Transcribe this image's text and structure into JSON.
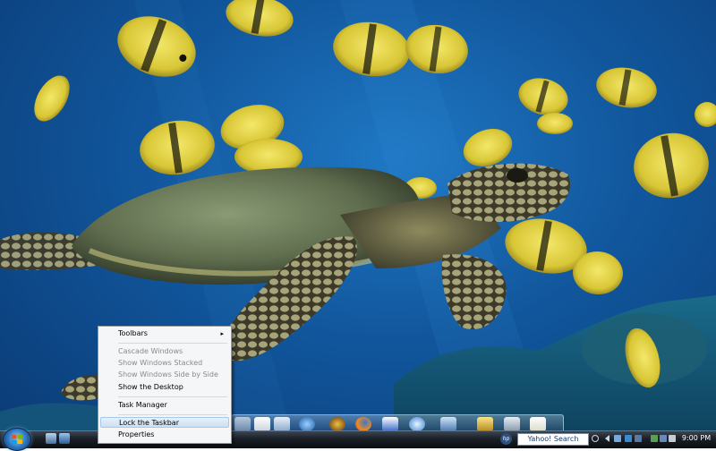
{
  "context_menu": {
    "items": [
      {
        "label": "Toolbars",
        "state": "normal",
        "submenu": true
      },
      {
        "label": "Cascade Windows",
        "state": "disabled"
      },
      {
        "label": "Show Windows Stacked",
        "state": "disabled"
      },
      {
        "label": "Show Windows Side by Side",
        "state": "disabled"
      },
      {
        "label": "Show the Desktop",
        "state": "normal"
      },
      {
        "label": "Task Manager",
        "state": "normal"
      },
      {
        "label": "Lock the Taskbar",
        "state": "highlighted"
      },
      {
        "label": "Properties",
        "state": "normal"
      }
    ],
    "submenu_arrow": "▸"
  },
  "taskbar": {
    "search_label": "Yahoo! Search",
    "hp_badge": "hp",
    "clock": "9:00 PM"
  },
  "dock": {
    "icons": [
      "folder-icon",
      "document-icon",
      "mail-icon",
      "globe-icon",
      "world-of-warcraft-icon",
      "firefox-icon",
      "word-icon",
      "safari-icon",
      "media-icon",
      "tool-icon",
      "recycle-bin-icon",
      "notepad-icon"
    ]
  },
  "colors": {
    "menu_bg": "#f4f6f8",
    "menu_highlight": "#cde0f4",
    "taskbar": "#1a1f26",
    "ocean": "#11569c"
  }
}
